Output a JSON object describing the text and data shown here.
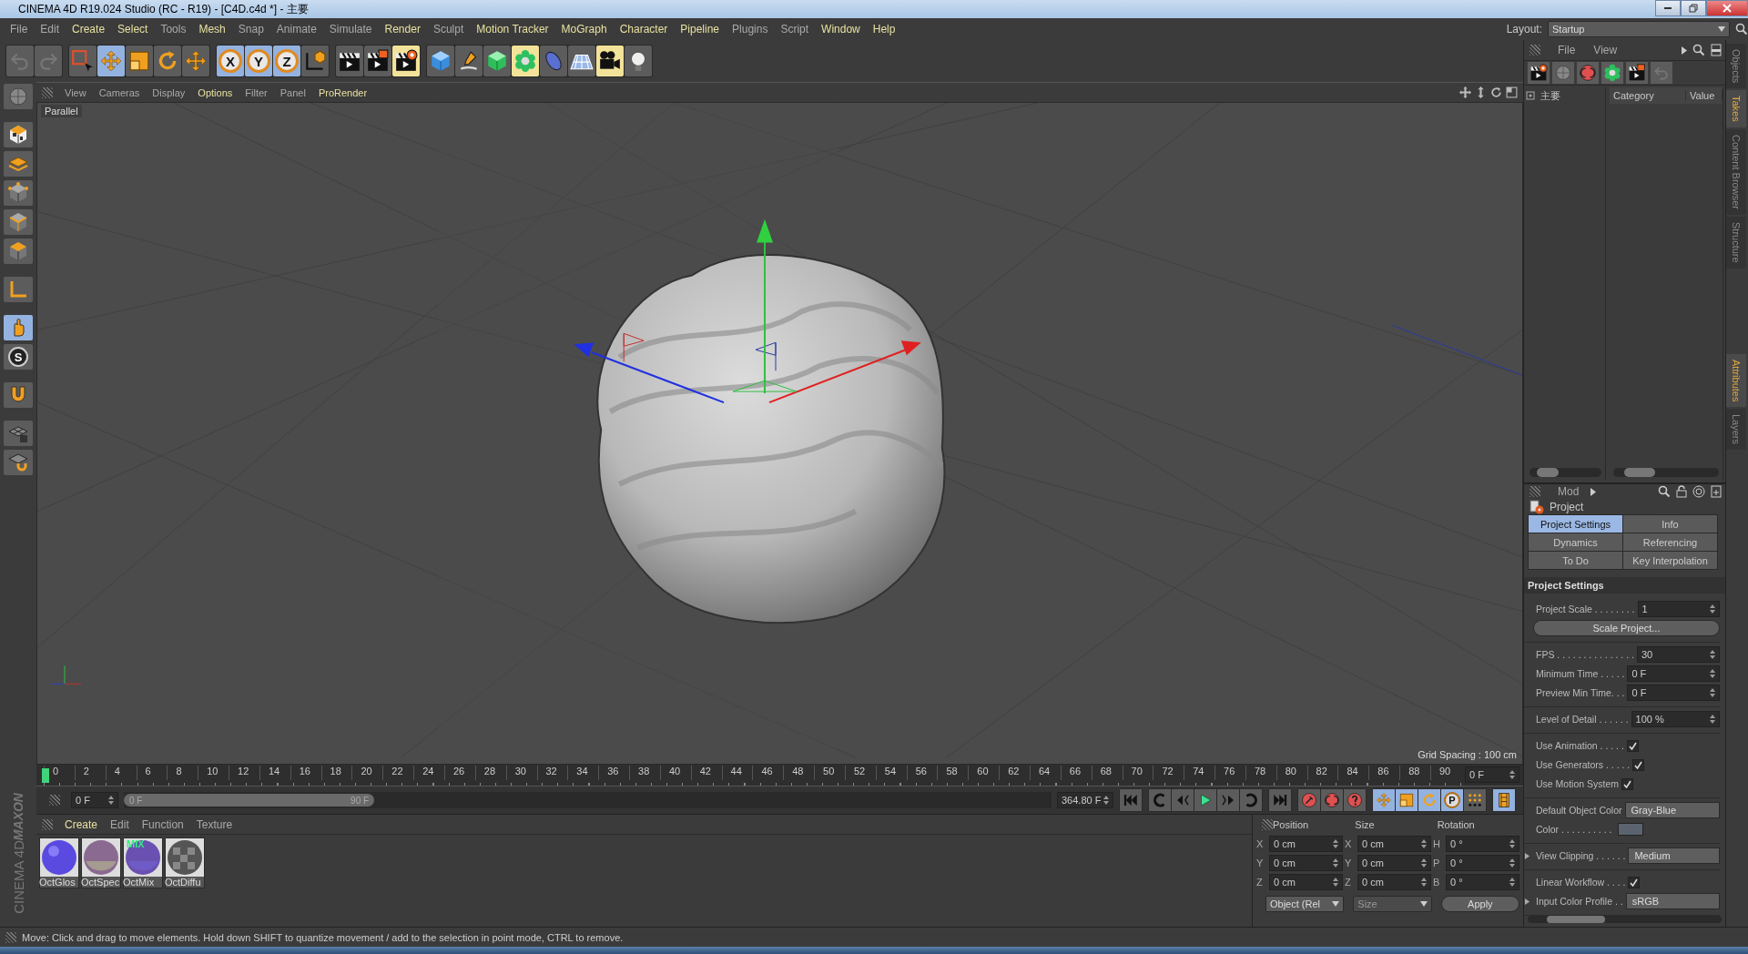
{
  "window": {
    "title": "CINEMA 4D R19.024 Studio (RC - R19) - [C4D.c4d *] - 主要"
  },
  "menu": [
    {
      "label": "File",
      "highlighted": false
    },
    {
      "label": "Edit",
      "highlighted": false
    },
    {
      "label": "Create",
      "highlighted": true
    },
    {
      "label": "Select",
      "highlighted": true
    },
    {
      "label": "Tools",
      "highlighted": false
    },
    {
      "label": "Mesh",
      "highlighted": true
    },
    {
      "label": "Snap",
      "highlighted": false
    },
    {
      "label": "Animate",
      "highlighted": false
    },
    {
      "label": "Simulate",
      "highlighted": false
    },
    {
      "label": "Render",
      "highlighted": true
    },
    {
      "label": "Sculpt",
      "highlighted": false
    },
    {
      "label": "Motion Tracker",
      "highlighted": true
    },
    {
      "label": "MoGraph",
      "highlighted": true
    },
    {
      "label": "Character",
      "highlighted": true
    },
    {
      "label": "Pipeline",
      "highlighted": true
    },
    {
      "label": "Plugins",
      "highlighted": false
    },
    {
      "label": "Script",
      "highlighted": false
    },
    {
      "label": "Window",
      "highlighted": true
    },
    {
      "label": "Help",
      "highlighted": true
    }
  ],
  "layout": {
    "label": "Layout:",
    "value": "Startup"
  },
  "toolbar": [
    [
      {
        "kind": "undo",
        "selected": false
      },
      {
        "kind": "redo",
        "selected": false
      }
    ],
    [
      {
        "kind": "live-select",
        "selected": false
      },
      {
        "kind": "move",
        "selected": true
      },
      {
        "kind": "scale",
        "selected": false
      },
      {
        "kind": "rotate",
        "selected": false
      },
      {
        "kind": "move",
        "selected": false
      }
    ],
    [
      {
        "kind": "axis",
        "label": "X",
        "selected": true
      },
      {
        "kind": "axis",
        "label": "Y",
        "selected": true
      },
      {
        "kind": "axis",
        "label": "Z",
        "selected": true
      },
      {
        "kind": "coordinate-system",
        "selected": false
      }
    ],
    [
      {
        "kind": "render-view",
        "selected": false
      },
      {
        "kind": "render-picture-viewer",
        "selected": false
      },
      {
        "kind": "render-settings",
        "selected": false
      }
    ],
    [
      {
        "kind": "cube",
        "selected": false
      },
      {
        "kind": "pen",
        "selected": false
      },
      {
        "kind": "subdivision",
        "selected": false
      },
      {
        "kind": "cloner",
        "selected": false
      },
      {
        "kind": "deformer",
        "selected": false
      },
      {
        "kind": "floor",
        "selected": false
      },
      {
        "kind": "camera",
        "selected": false
      },
      {
        "kind": "light",
        "selected": false
      }
    ]
  ],
  "left_tools": [
    {
      "kind": "make-editable",
      "selected": false
    },
    {
      "kind": "texture",
      "selected": false
    },
    {
      "kind": "workplane",
      "selected": false
    },
    {
      "kind": "points",
      "selected": false
    },
    {
      "kind": "edges",
      "selected": false
    },
    {
      "kind": "polygons",
      "selected": false
    },
    {
      "kind": "axis-mode",
      "selected": false
    },
    {
      "kind": "tweak",
      "selected": true
    },
    {
      "kind": "snap",
      "label": "S",
      "selected": false
    },
    {
      "kind": "magnet",
      "selected": false
    },
    {
      "kind": "grid-lock",
      "selected": false
    },
    {
      "kind": "grid-snap",
      "selected": false
    }
  ],
  "viewport": {
    "menu": [
      {
        "label": "View",
        "highlighted": false
      },
      {
        "label": "Cameras",
        "highlighted": false
      },
      {
        "label": "Display",
        "highlighted": false
      },
      {
        "label": "Options",
        "highlighted": true
      },
      {
        "label": "Filter",
        "highlighted": false
      },
      {
        "label": "Panel",
        "highlighted": false
      },
      {
        "label": "ProRender",
        "highlighted": true
      }
    ],
    "camera_label": "Parallel",
    "grid_label": "Grid Spacing : 100 cm"
  },
  "timeline": {
    "ticks": [
      "0",
      "2",
      "4",
      "6",
      "8",
      "10",
      "12",
      "14",
      "16",
      "18",
      "20",
      "22",
      "24",
      "26",
      "28",
      "30",
      "32",
      "34",
      "36",
      "38",
      "40",
      "42",
      "44",
      "46",
      "48",
      "50",
      "52",
      "54",
      "56",
      "58",
      "60",
      "62",
      "64",
      "66",
      "68",
      "70",
      "72",
      "74",
      "76",
      "78",
      "80",
      "82",
      "84",
      "86",
      "88",
      "90"
    ],
    "level": 0,
    "current": "0 F"
  },
  "range": {
    "start": "0 F",
    "min": "0 F",
    "max": "90 F",
    "end": "364.80 F",
    "level": 0.27
  },
  "playback": [
    {
      "kind": "goto-start",
      "selected": false
    },
    {
      "kind": "prev-key",
      "selected": false
    },
    {
      "kind": "prev-frame",
      "selected": false
    },
    {
      "kind": "play",
      "selected": false
    },
    {
      "kind": "next-frame",
      "selected": false
    },
    {
      "kind": "next-key",
      "selected": false
    },
    {
      "kind": "goto-end",
      "selected": false
    },
    {
      "kind": "record",
      "selected": false
    },
    {
      "kind": "autokey",
      "selected": false
    },
    {
      "kind": "keyset",
      "selected": false
    },
    {
      "kind": "key-position",
      "selected": true
    },
    {
      "kind": "key-scale",
      "selected": true
    },
    {
      "kind": "key-rotation",
      "selected": true
    },
    {
      "kind": "key-parameter",
      "label": "P",
      "selected": true
    },
    {
      "kind": "key-pla",
      "selected": false
    },
    {
      "kind": "timeline",
      "selected": true
    }
  ],
  "materials": {
    "menu": [
      {
        "label": "Create",
        "highlighted": true
      },
      {
        "label": "Edit",
        "highlighted": false
      },
      {
        "label": "Function",
        "highlighted": false
      },
      {
        "label": "Texture",
        "highlighted": false
      }
    ],
    "items": [
      {
        "name": "OctGlos",
        "kind": "glossy"
      },
      {
        "name": "OctSpec",
        "kind": "specular"
      },
      {
        "name": "OctMix",
        "kind": "mix",
        "badge": "MIX"
      },
      {
        "name": "OctDiffu",
        "kind": "diffuse"
      }
    ]
  },
  "logo": {
    "brand": "MAXON",
    "product": "CINEMA 4D"
  },
  "coordinates": {
    "headers": [
      "Position",
      "Size",
      "Rotation"
    ],
    "rows": [
      {
        "axis": "X",
        "position": "0 cm",
        "size_axis": "X",
        "size": "0 cm",
        "rotation_axis": "H",
        "rotation": "0 °"
      },
      {
        "axis": "Y",
        "position": "0 cm",
        "size_axis": "Y",
        "size": "0 cm",
        "rotation_axis": "P",
        "rotation": "0 °"
      },
      {
        "axis": "Z",
        "position": "0 cm",
        "size_axis": "Z",
        "size": "0 cm",
        "rotation_axis": "B",
        "rotation": "0 °"
      }
    ],
    "mode": {
      "label": "Object (Rel",
      "disabled": false
    },
    "size_mode": {
      "label": "Size",
      "disabled": true
    },
    "apply": "Apply"
  },
  "objects_panel": {
    "menu": [
      "File",
      "View"
    ],
    "tree": [
      {
        "label": "主要"
      }
    ],
    "columns": [
      "Category",
      "Value"
    ]
  },
  "attributes": {
    "menu": "Mod",
    "title": "Project",
    "tabs": [
      {
        "label": "Project Settings",
        "selected": true
      },
      {
        "label": "Info",
        "selected": false
      },
      {
        "label": "Dynamics",
        "selected": false
      },
      {
        "label": "Referencing",
        "selected": false
      },
      {
        "label": "To Do",
        "selected": false
      },
      {
        "label": "Key Interpolation",
        "selected": false
      }
    ],
    "section": "Project Settings",
    "groups": [
      [
        {
          "kind": "field",
          "label": "Project Scale . . . . . . . .",
          "value": "1"
        },
        {
          "kind": "button",
          "label": "Scale Project..."
        }
      ],
      [
        {
          "kind": "field",
          "label": "FPS . . . . . . . . . . . . . . .",
          "value": "30"
        },
        {
          "kind": "field",
          "label": "Minimum Time . . . . .",
          "value": "0 F"
        },
        {
          "kind": "field",
          "label": "Preview Min Time. . .",
          "value": "0 F"
        }
      ],
      [
        {
          "kind": "field",
          "label": "Level of Detail . . . . . .",
          "value": "100 %"
        }
      ],
      [
        {
          "kind": "checkbox",
          "label": "Use Animation . . . . .",
          "checked": true
        },
        {
          "kind": "checkbox",
          "label": "Use Generators . . . . .",
          "checked": true
        },
        {
          "kind": "checkbox",
          "label": "Use Motion System",
          "checked": true
        }
      ],
      [
        {
          "kind": "dropdown",
          "label": "Default Object Color",
          "value": "Gray-Blue"
        },
        {
          "kind": "color",
          "label": "Color . . . . . . . . . .",
          "color": "#5c6370"
        }
      ],
      [
        {
          "kind": "dropdown",
          "label": "View Clipping . . . . . .",
          "value": "Medium",
          "expanded": false
        }
      ],
      [
        {
          "kind": "checkbox",
          "label": "Linear Workflow . . . .",
          "checked": true
        },
        {
          "kind": "dropdown",
          "label": "Input Color Profile . .",
          "value": "sRGB",
          "expanded": false
        }
      ]
    ]
  },
  "side_tabs": {
    "top": [
      {
        "label": "Objects",
        "selected": false
      },
      {
        "label": "Takes",
        "selected": true
      },
      {
        "label": "Content Browser",
        "selected": false
      },
      {
        "label": "Structure",
        "selected": false
      }
    ],
    "bottom": [
      {
        "label": "Attributes",
        "selected": true
      },
      {
        "label": "Layers",
        "selected": false
      }
    ]
  },
  "status_bar": "Move: Click and drag to move elements. Hold down SHIFT to quantize movement / add to the selection in point mode, CTRL to remove."
}
